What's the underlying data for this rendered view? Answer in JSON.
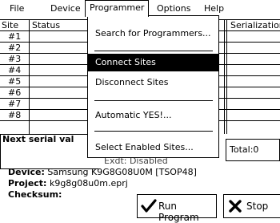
{
  "menubar": {
    "items": [
      "File",
      "Device",
      "Programmer",
      "Options",
      "Help"
    ]
  },
  "sites_table": {
    "headers": {
      "site": "Site",
      "status": "Status",
      "serialization": "Serialization"
    },
    "rows": [
      "#1",
      "#2",
      "#3",
      "#4",
      "#5",
      "#6",
      "#7",
      "#8"
    ]
  },
  "programmer_menu": {
    "items": [
      {
        "label": "Search for Programmers...",
        "selected": false
      },
      {
        "label": "Connect Sites",
        "selected": true
      },
      {
        "label": "Disconnect Sites",
        "selected": false
      },
      {
        "label": "Automatic YES!...",
        "selected": false
      },
      {
        "label": "Select Enabled Sites...",
        "selected": false
      }
    ]
  },
  "next_serial": {
    "title": "Next serial val"
  },
  "extra_status": "Exdt: Disabled",
  "total": "Total:0",
  "info": {
    "device_label": "Device:",
    "device_value": "Samsung  K9G8G08U0M [TSOP48]",
    "project_label": "Project:",
    "project_value": "k9g8g08u0m.eprj",
    "checksum_label": "Checksum:"
  },
  "buttons": {
    "run_program": "Run Program",
    "stop": "Stop"
  },
  "colors": {
    "selected_bg": "#000000",
    "selected_fg": "#ffffff"
  }
}
